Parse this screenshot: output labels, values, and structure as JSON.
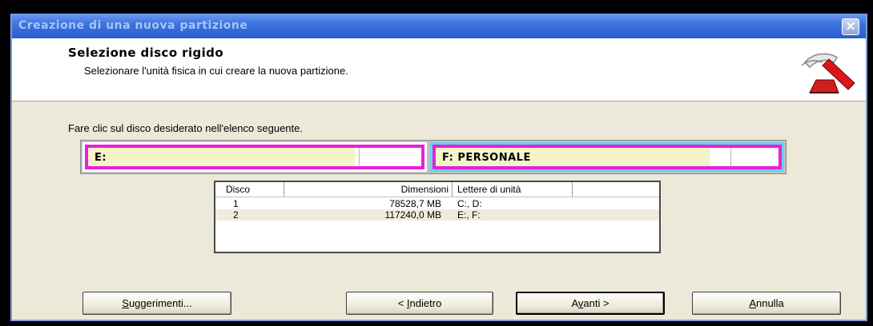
{
  "window": {
    "title": "Creazione di una nuova partizione",
    "close_glyph": "✕"
  },
  "header": {
    "title": "Selezione disco rigido",
    "subtitle": "Selezionare l'unità fisica in cui creare la nuova partizione.",
    "icon": "hammer-wizard-icon"
  },
  "instruction": "Fare clic sul disco desiderato nell'elenco seguente.",
  "partitions": [
    {
      "label": "E:"
    },
    {
      "label": "F:  PERSONALE"
    }
  ],
  "table": {
    "columns": [
      "Disco",
      "Dimensioni",
      "Lettere di unità"
    ],
    "rows": [
      {
        "disco": "1",
        "dimensioni": "78528,7 MB",
        "lettere": "C:, D:"
      },
      {
        "disco": "2",
        "dimensioni": "117240,0 MB",
        "lettere": "E:, F:"
      }
    ]
  },
  "buttons": {
    "help_prefix": "S",
    "help_rest": "uggerimenti...",
    "back_prefix": "< ",
    "back_u": "I",
    "back_rest": "ndietro",
    "next_pre": "A",
    "next_u": "v",
    "next_rest": "anti >",
    "cancel_u": "A",
    "cancel_rest": "nnulla"
  },
  "colors": {
    "partition_highlight": "#e820d8",
    "selected_partition_bg": "#5fd8e8",
    "title_bar": "#2a5ccf"
  }
}
